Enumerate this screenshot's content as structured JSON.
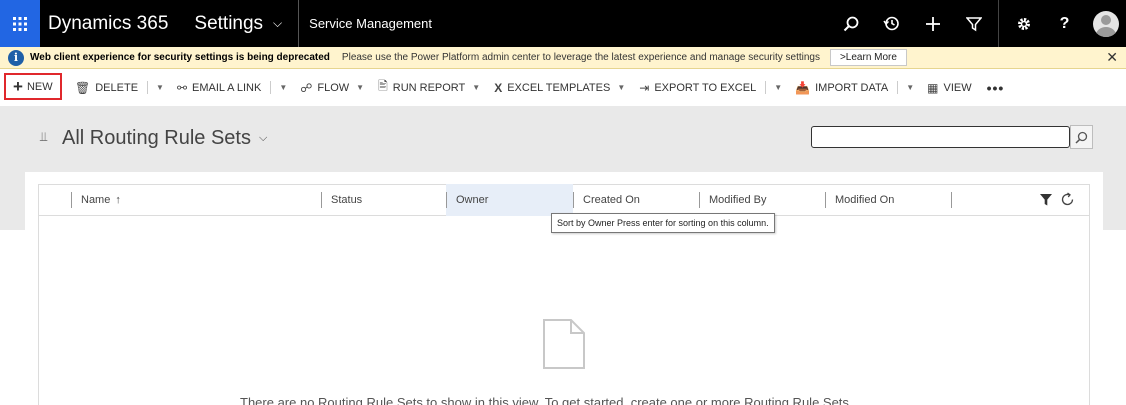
{
  "topbar": {
    "app_name": "Dynamics 365",
    "area": "Settings",
    "breadcrumb": "Service Management"
  },
  "banner": {
    "title": "Web client experience for security settings is being deprecated",
    "message": "Please use the Power Platform admin center to leverage the latest experience and manage security settings",
    "button": ">Learn More"
  },
  "commands": {
    "new": "NEW",
    "delete": "DELETE",
    "email_link": "EMAIL A LINK",
    "flow": "FLOW",
    "run_report": "RUN REPORT",
    "excel_templates": "EXCEL TEMPLATES",
    "export_excel": "EXPORT TO EXCEL",
    "import_data": "IMPORT DATA",
    "view": "VIEW"
  },
  "view": {
    "title": "All Routing Rule Sets"
  },
  "grid": {
    "columns": [
      "Name",
      "Status",
      "Owner",
      "Created On",
      "Modified By",
      "Modified On"
    ],
    "sort_column": "Name",
    "tooltip": "Sort by Owner Press enter for sorting on this column.",
    "empty_message": "There are no Routing Rule Sets to show in this view. To get started, create one or more Routing Rule Sets."
  },
  "colors": {
    "topbar": "#000000",
    "waffle": "#2266e3",
    "banner": "#fff4ce",
    "highlight_border": "#e0282c"
  }
}
